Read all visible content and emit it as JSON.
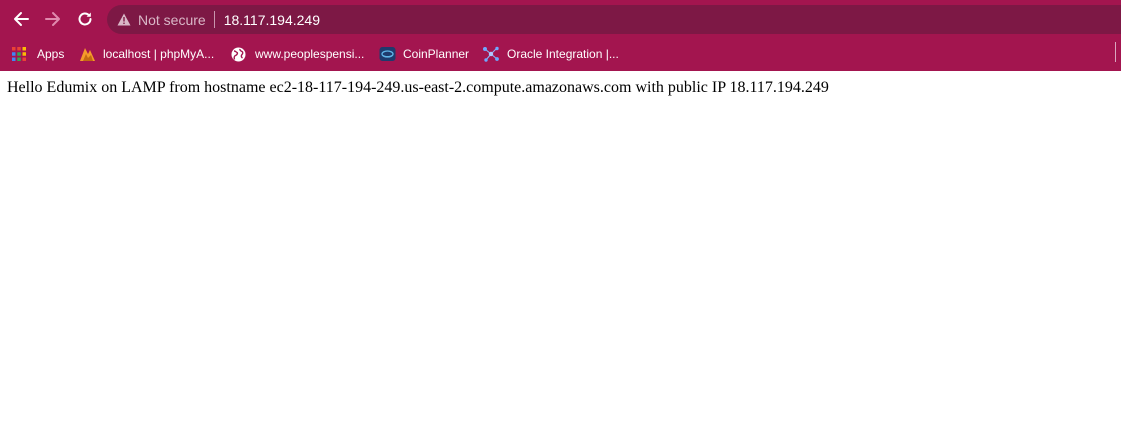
{
  "browser": {
    "security_label": "Not secure",
    "url": "18.117.194.249",
    "colors": {
      "frame": "#a3154f",
      "omnibox": "#7d1845"
    }
  },
  "bookmarks": [
    {
      "label": "Apps",
      "icon": "apps-grid-icon"
    },
    {
      "label": "localhost | phpMyA...",
      "icon": "phpmyadmin-icon"
    },
    {
      "label": "www.peoplespensi...",
      "icon": "globe-icon"
    },
    {
      "label": "CoinPlanner",
      "icon": "coinplanner-icon"
    },
    {
      "label": "Oracle Integration |...",
      "icon": "oracle-integration-icon"
    }
  ],
  "page": {
    "text": "Hello Edumix on LAMP from hostname ec2-18-117-194-249.us-east-2.compute.amazonaws.com with public IP 18.117.194.249"
  }
}
